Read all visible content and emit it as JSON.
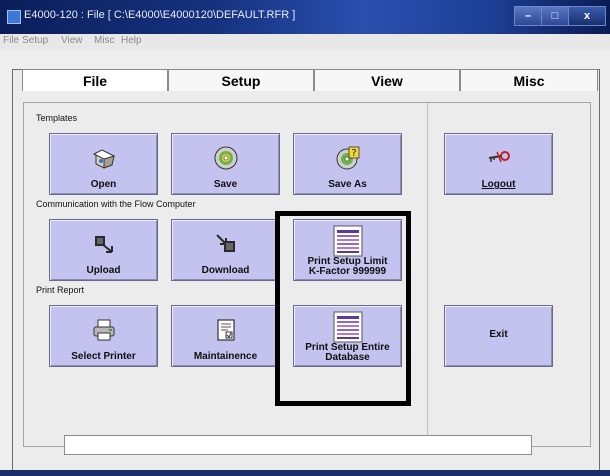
{
  "window": {
    "title": "E4000-120 : File [ C:\\E4000\\E4000120\\DEFAULT.RFR ]",
    "controls": {
      "minimize": "–",
      "maximize": "□",
      "close": "x"
    }
  },
  "menu": [
    "File",
    "Setup",
    "View",
    "Misc",
    "Help"
  ],
  "tabs": [
    {
      "label": "File",
      "active": true
    },
    {
      "label": "Setup",
      "active": false
    },
    {
      "label": "View",
      "active": false
    },
    {
      "label": "Misc",
      "active": false
    }
  ],
  "sections": {
    "templates": "Templates",
    "communication": "Communication with the Flow Computer",
    "print_report": "Print Report"
  },
  "buttons": {
    "open": "Open",
    "save": "Save",
    "save_as": "Save As",
    "logout": "Logout",
    "upload": "Upload",
    "download": "Download",
    "print_setup_limit_1": "Print Setup Limit",
    "print_setup_limit_2": "K-Factor 999999",
    "select_printer": "Select Printer",
    "maintenance": "Maintainence",
    "print_entire_1": "Print Setup Entire",
    "print_entire_2": "Database",
    "exit": "Exit"
  },
  "status_text": "",
  "colors": {
    "button_face": "#c4c2ee",
    "titlebar": "#15327e",
    "highlight_border": "#000000"
  }
}
